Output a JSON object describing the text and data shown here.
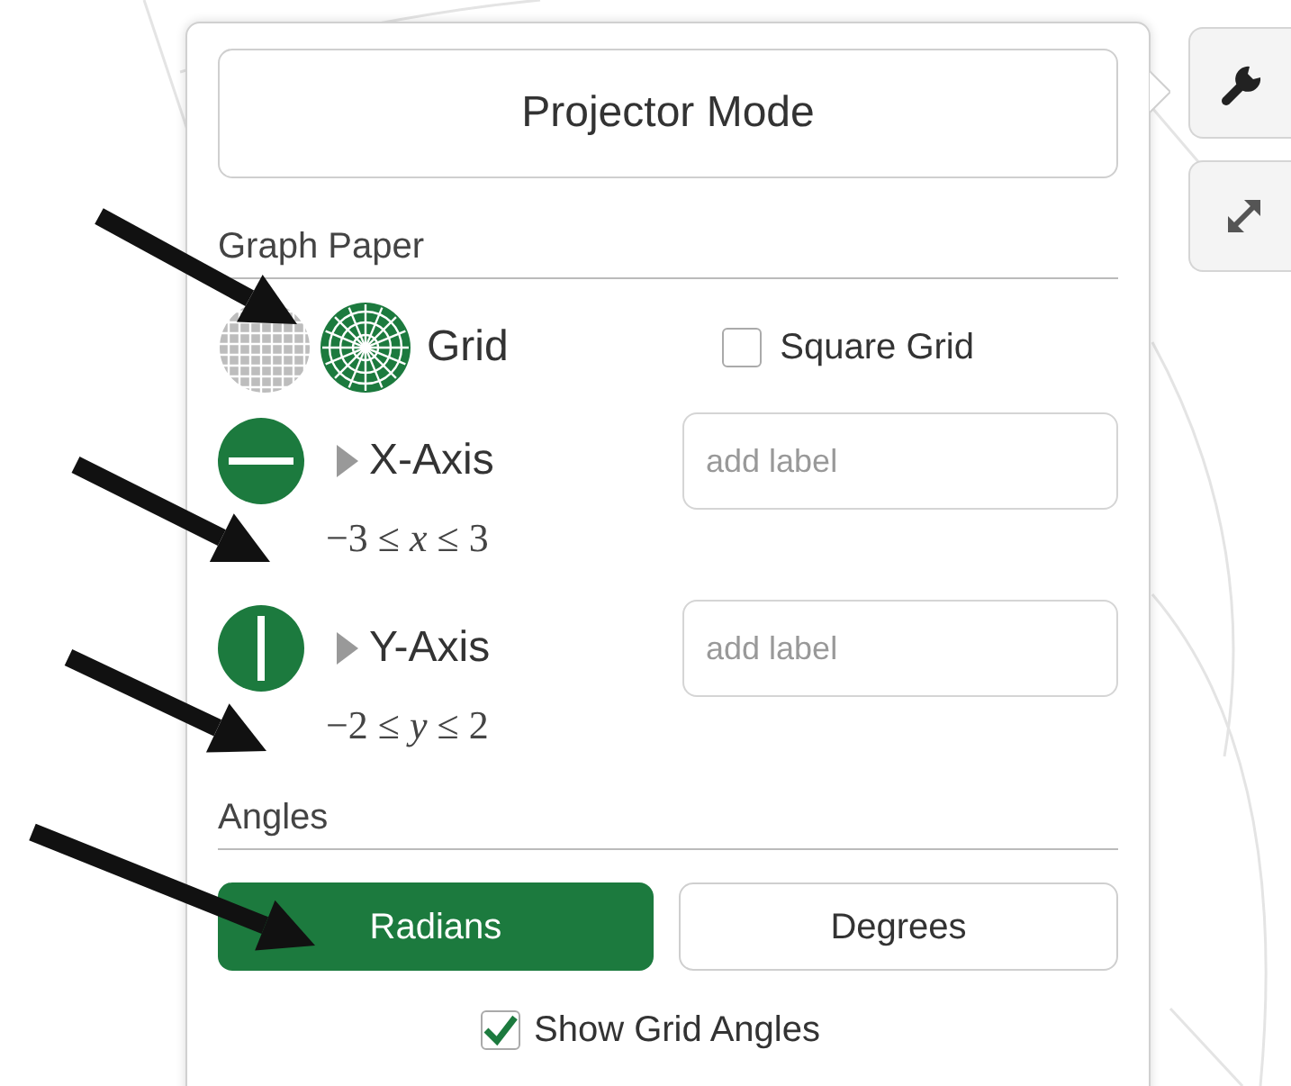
{
  "projector_mode": {
    "label": "Projector Mode"
  },
  "graph_paper": {
    "heading": "Graph Paper",
    "grid_types": [
      {
        "kind": "cartesian",
        "selected": false
      },
      {
        "kind": "polar",
        "selected": true
      }
    ],
    "grid_label": "Grid",
    "square_grid": {
      "label": "Square Grid",
      "checked": false
    },
    "axes": [
      {
        "kind": "x",
        "shown": true,
        "label": "X-Axis",
        "expanded": false,
        "placeholder": "add label",
        "range": "−3 ≤ *x* ≤ 3"
      },
      {
        "kind": "y",
        "shown": true,
        "label": "Y-Axis",
        "expanded": false,
        "placeholder": "add label",
        "range": "−2 ≤ *y* ≤ 2"
      }
    ]
  },
  "angles": {
    "heading": "Angles",
    "options": [
      {
        "label": "Radians",
        "selected": true
      },
      {
        "label": "Degrees",
        "selected": false
      }
    ],
    "show_grid_angles": {
      "label": "Show Grid Angles",
      "checked": true
    }
  },
  "side_buttons": [
    {
      "kind": "wrench"
    },
    {
      "kind": "resize"
    }
  ]
}
